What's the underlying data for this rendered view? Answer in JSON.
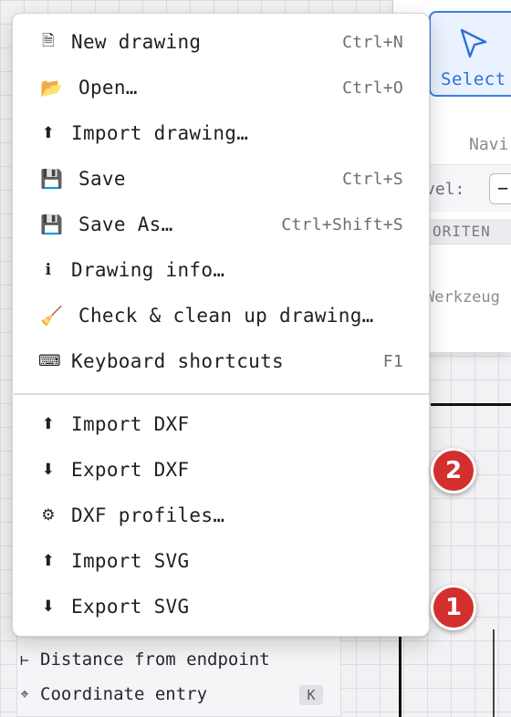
{
  "ribbon": {
    "select_tool_label": "Select",
    "navi_tab": "Navi",
    "level_label": "vel:",
    "level_stepper": "−",
    "favorites_header": "ORITEN",
    "favorites_empty": "Werkzeug"
  },
  "menu": {
    "items": [
      {
        "icon": "🗎",
        "icon_name": "new-document-icon",
        "label": "New drawing",
        "shortcut": "Ctrl+N"
      },
      {
        "icon": "📂",
        "icon_name": "open-folder-icon",
        "label": "Open…",
        "shortcut": "Ctrl+O"
      },
      {
        "icon": "⬆",
        "icon_name": "upload-arrow-icon",
        "label": "Import drawing…",
        "shortcut": ""
      },
      {
        "icon": "💾",
        "icon_name": "floppy-disk-icon",
        "label": "Save",
        "shortcut": "Ctrl+S"
      },
      {
        "icon": "💾",
        "icon_name": "floppy-disk-icon",
        "label": "Save As…",
        "shortcut": "Ctrl+Shift+S"
      },
      {
        "icon": "ℹ",
        "icon_name": "info-icon",
        "label": "Drawing info…",
        "shortcut": ""
      },
      {
        "icon": "🧹",
        "icon_name": "broom-icon",
        "label": "Check & clean up drawing…",
        "shortcut": ""
      },
      {
        "icon": "⌨",
        "icon_name": "keyboard-icon",
        "label": "Keyboard shortcuts",
        "shortcut": "F1"
      },
      {
        "icon": "⬆",
        "icon_name": "upload-arrow-icon",
        "label": "Import DXF",
        "shortcut": ""
      },
      {
        "icon": "⬇",
        "icon_name": "download-arrow-icon",
        "label": "Export DXF",
        "shortcut": ""
      },
      {
        "icon": "⚙",
        "icon_name": "gear-icon",
        "label": "DXF profiles…",
        "shortcut": ""
      },
      {
        "icon": "⬆",
        "icon_name": "upload-arrow-icon",
        "label": "Import SVG",
        "shortcut": ""
      },
      {
        "icon": "⬇",
        "icon_name": "download-arrow-icon",
        "label": "Export SVG",
        "shortcut": ""
      }
    ]
  },
  "snap_panel": {
    "rows": [
      {
        "symbol": "⊢",
        "label": "Distance from endpoint"
      },
      {
        "symbol": "⌖",
        "label": "Coordinate entry"
      }
    ],
    "coordinate_key": "K"
  },
  "badges": [
    "2",
    "1"
  ],
  "colors": {
    "accent": "#3b7de0",
    "badge": "#d32f2f",
    "menu_bg": "#ffffff"
  }
}
